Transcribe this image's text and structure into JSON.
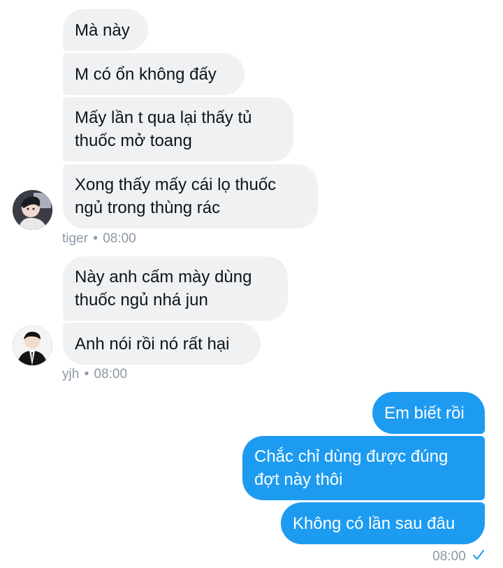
{
  "group1": {
    "messages": [
      "Mà này",
      "M có ổn không đấy",
      "Mấy lần t qua lại thấy tủ\nthuốc mở toang",
      "Xong thấy mấy cái lọ thuốc\nngủ trong thùng rác"
    ],
    "sender": "tiger",
    "time": "08:00"
  },
  "group2": {
    "messages": [
      "Này anh cấm mày dùng\nthuốc ngủ nhá jun",
      "Anh nói rồi nó rất hại"
    ],
    "sender": "yjh",
    "time": "08:00"
  },
  "outgoing": {
    "messages": [
      "Em biết rồi",
      "Chắc chỉ dùng được đúng\nđợt này thôi",
      "Không có lần sau đâu"
    ],
    "time": "08:00",
    "status_icon": "sent-check-icon"
  },
  "separator": "•",
  "colors": {
    "incoming_bubble": "#eff1f3",
    "outgoing_bubble": "#1d9bf0",
    "meta_text": "#8b98a5"
  }
}
